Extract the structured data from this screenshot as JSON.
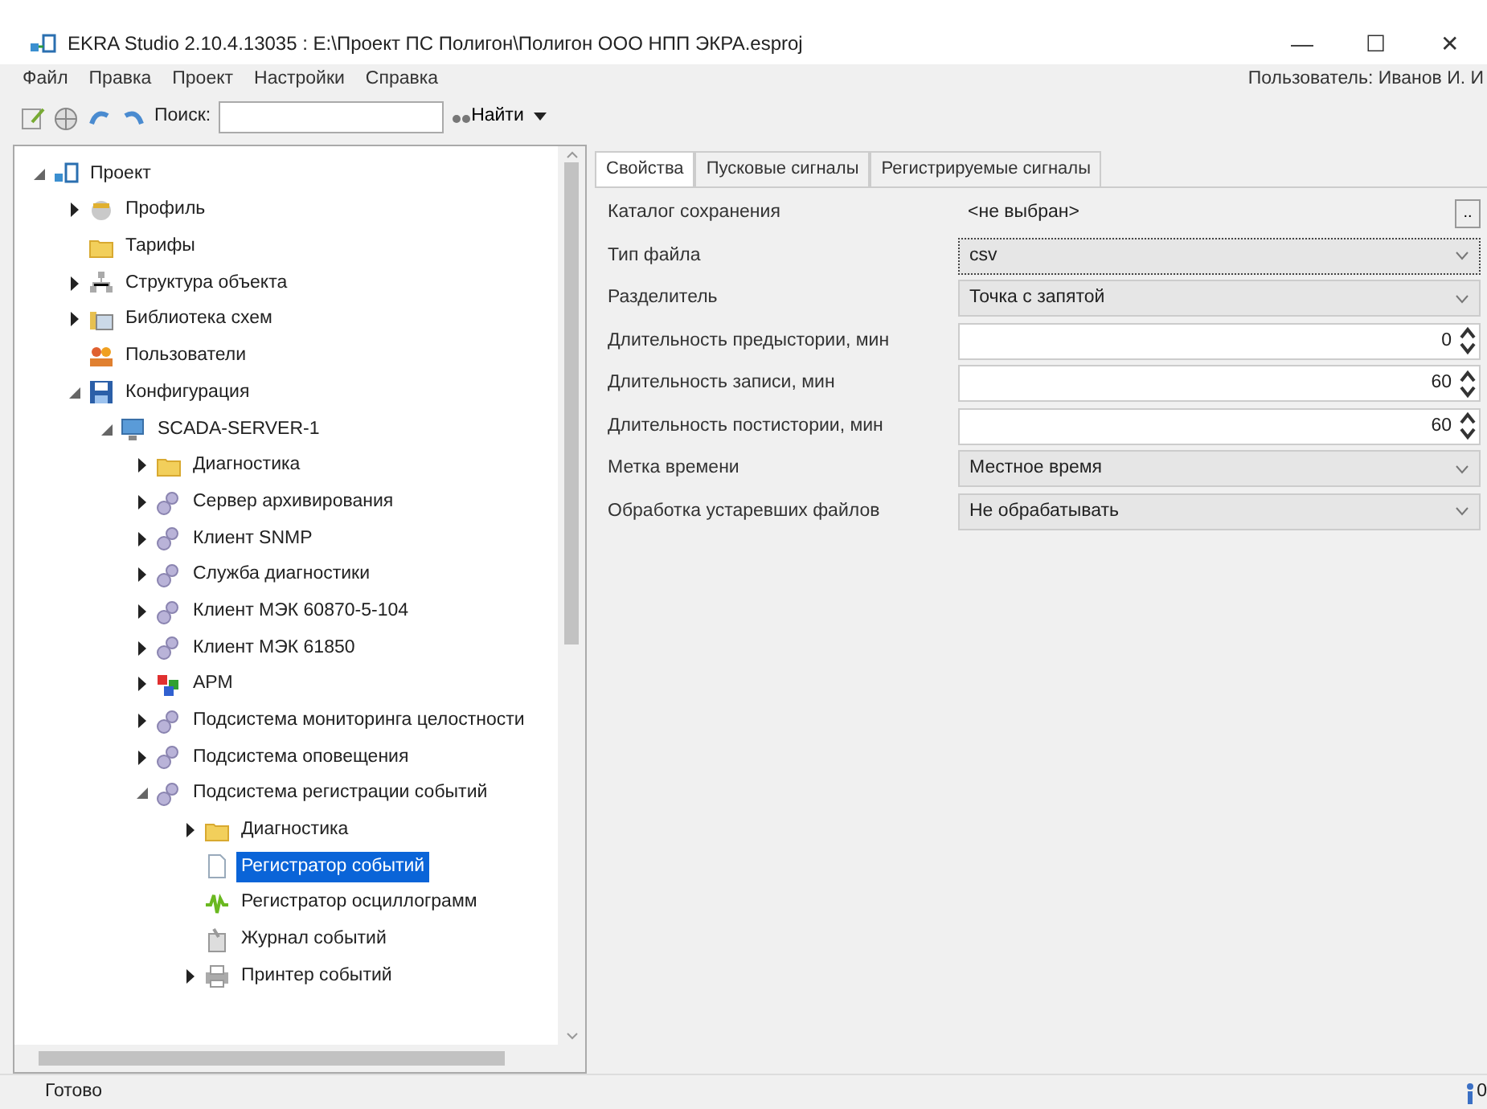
{
  "window": {
    "title": "EKRA Studio 2.10.4.13035 : E:\\Проект ПС Полигон\\Полигон ООО НПП ЭКРА.esproj",
    "controls": [
      "—",
      "☐",
      "✕"
    ]
  },
  "menu": [
    "Файл",
    "Правка",
    "Проект",
    "Настройки",
    "Справка"
  ],
  "user": "Пользователь: Иванов И. И",
  "toolbar": {
    "search_label": "Поиск:",
    "find_button": "Найти"
  },
  "tree": [
    {
      "label": "Проект",
      "kind": "project",
      "expandable": true,
      "expanded": true,
      "selected": false,
      "children": [
        {
          "label": "Профиль",
          "kind": "profile",
          "expandable": true,
          "expanded": false,
          "selected": false
        },
        {
          "label": "Тарифы",
          "kind": "folder",
          "expandable": false,
          "selected": false
        },
        {
          "label": "Структура объекта",
          "kind": "structure",
          "expandable": true,
          "expanded": false,
          "selected": false
        },
        {
          "label": "Библиотека схем",
          "kind": "library",
          "expandable": true,
          "expanded": false,
          "selected": false
        },
        {
          "label": "Пользователи",
          "kind": "users",
          "expandable": false,
          "selected": false
        },
        {
          "label": "Конфигурация",
          "kind": "disk",
          "expandable": true,
          "expanded": true,
          "selected": false,
          "children": [
            {
              "label": "SCADA-SERVER-1",
              "kind": "server",
              "expandable": true,
              "expanded": true,
              "selected": false,
              "children": [
                {
                  "label": "Диагностика",
                  "kind": "folder",
                  "expandable": true,
                  "expanded": false,
                  "selected": false
                },
                {
                  "label": "Сервер архивирования",
                  "kind": "gear",
                  "expandable": true,
                  "expanded": false,
                  "selected": false
                },
                {
                  "label": "Клиент SNMP",
                  "kind": "gear",
                  "expandable": true,
                  "expanded": false,
                  "selected": false
                },
                {
                  "label": "Служба диагностики",
                  "kind": "gear",
                  "expandable": true,
                  "expanded": false,
                  "selected": false
                },
                {
                  "label": "Клиент МЭК 60870-5-104",
                  "kind": "gear",
                  "expandable": true,
                  "expanded": false,
                  "selected": false
                },
                {
                  "label": "Клиент МЭК 61850",
                  "kind": "gear",
                  "expandable": true,
                  "expanded": false,
                  "selected": false
                },
                {
                  "label": "АРМ",
                  "kind": "arm",
                  "expandable": true,
                  "expanded": false,
                  "selected": false
                },
                {
                  "label": "Подсистема мониторинга целостности",
                  "kind": "gear",
                  "expandable": true,
                  "expanded": false,
                  "selected": false
                },
                {
                  "label": "Подсистема оповещения",
                  "kind": "gear",
                  "expandable": true,
                  "expanded": false,
                  "selected": false
                },
                {
                  "label": "Подсистема регистрации событий",
                  "kind": "gear",
                  "expandable": true,
                  "expanded": true,
                  "selected": false,
                  "children": [
                    {
                      "label": "Диагностика",
                      "kind": "folder",
                      "expandable": true,
                      "expanded": false,
                      "selected": false
                    },
                    {
                      "label": "Регистратор событий",
                      "kind": "document",
                      "expandable": false,
                      "selected": true
                    },
                    {
                      "label": "Регистратор осциллограмм",
                      "kind": "wave",
                      "expandable": false,
                      "selected": false
                    },
                    {
                      "label": "Журнал событий",
                      "kind": "journal",
                      "expandable": false,
                      "selected": false
                    },
                    {
                      "label": "Принтер событий",
                      "kind": "printer",
                      "expandable": true,
                      "expanded": false,
                      "selected": false
                    }
                  ]
                }
              ]
            }
          ]
        }
      ]
    }
  ],
  "tabs": [
    {
      "label": "Свойства",
      "selected": true
    },
    {
      "label": "Пусковые сигналы",
      "selected": false
    },
    {
      "label": "Регистрируемые сигналы",
      "selected": false
    }
  ],
  "properties": [
    {
      "label": "Каталог сохранения",
      "kind": "path",
      "value": "<не выбран>",
      "button": "..",
      "focused": false
    },
    {
      "label": "Тип файла",
      "kind": "combo",
      "value": "csv",
      "focused": true
    },
    {
      "label": "Разделитель",
      "kind": "combo",
      "value": "Точка с запятой",
      "focused": false
    },
    {
      "label": "Длительность предыстории, мин",
      "kind": "spin",
      "value": "0",
      "focused": false
    },
    {
      "label": "Длительность записи, мин",
      "kind": "spin",
      "value": "60",
      "focused": false
    },
    {
      "label": "Длительность постистории, мин",
      "kind": "spin",
      "value": "60",
      "focused": false
    },
    {
      "label": "Метка времени",
      "kind": "combo",
      "value": "Местное время",
      "focused": false
    },
    {
      "label": "Обработка устаревших файлов",
      "kind": "combo",
      "value": "Не обрабатывать",
      "focused": false
    }
  ],
  "status_bar": {
    "text": "Готово",
    "counter": "0"
  }
}
